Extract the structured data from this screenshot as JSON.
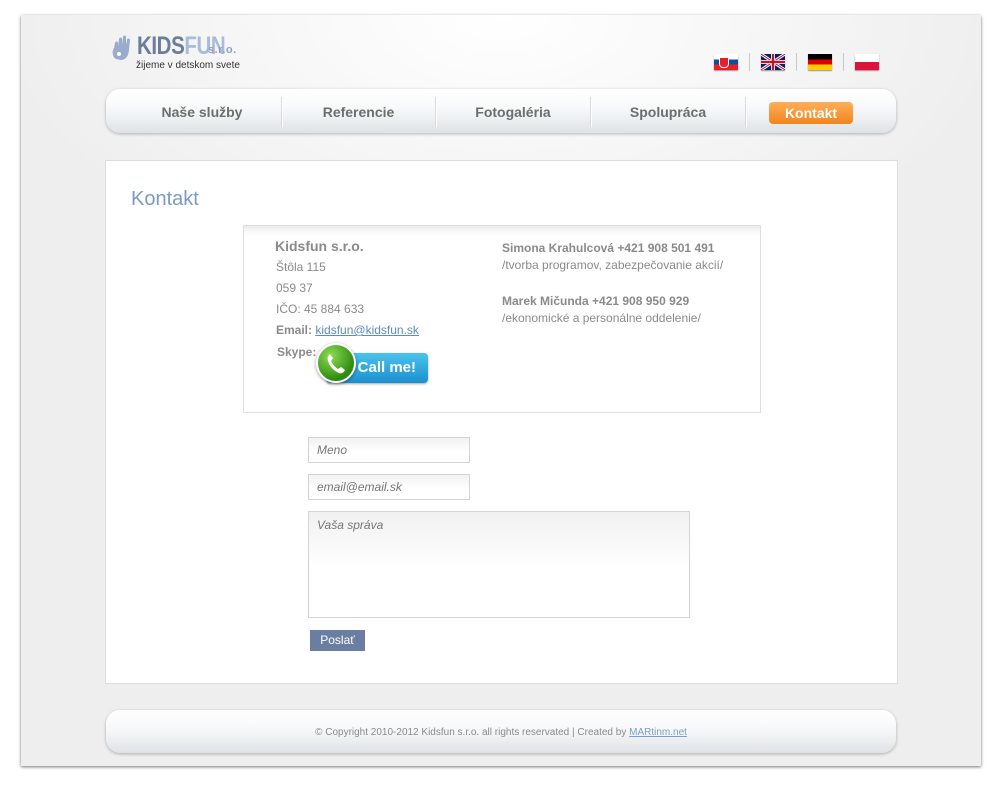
{
  "header": {
    "brand_kids": "KIDS",
    "brand_fun": "FUN",
    "brand_suffix": "s.r.o.",
    "tagline": "žijeme v detskom svete",
    "languages": [
      "sk",
      "en",
      "de",
      "pl"
    ]
  },
  "nav": {
    "items": [
      "Naše služby",
      "Referencie",
      "Fotogaléria",
      "Spolupráca"
    ],
    "active": "Kontakt",
    "active_color": "#f6921e"
  },
  "page": {
    "title": "Kontakt"
  },
  "contact": {
    "company": "Kidsfun s.r.o.",
    "street": "Štôla 115",
    "zip": "059 37",
    "ico": "IČO: 45 884 633",
    "email_label": "Email:",
    "email": "kidsfun@kidsfun.sk",
    "skype_label": "Skype:",
    "skype_button": "Call me!",
    "people": [
      {
        "name": "Simona Krahulcová +421 908 501 491",
        "role": "/tvorba programov, zabezpečovanie akcií/"
      },
      {
        "name": "Marek Mičunda +421 908 950 929",
        "role": "/ekonomické a personálne oddelenie/"
      }
    ]
  },
  "form": {
    "name_placeholder": "Meno",
    "email_placeholder": "email@email.sk",
    "message_placeholder": "Vaša správa",
    "submit_label": "Poslať"
  },
  "footer": {
    "copyright": "© Copyright 2010-2012 Kidsfun s.r.o. all rights reservated | Created by",
    "author": "MARtinm.net"
  }
}
